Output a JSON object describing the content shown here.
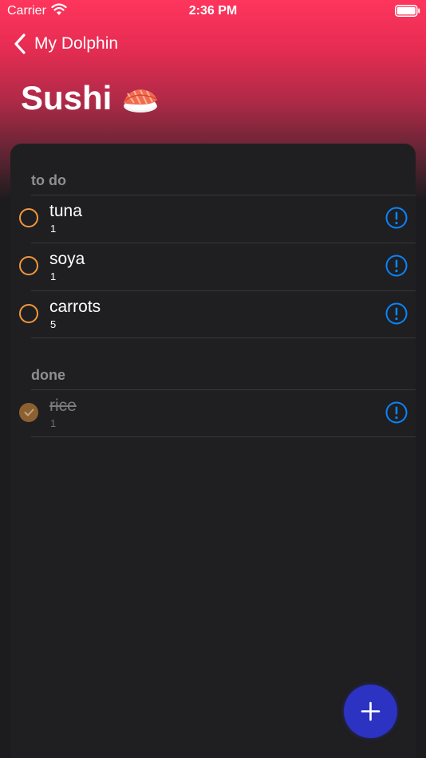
{
  "status_bar": {
    "carrier": "Carrier",
    "time": "2:36 PM"
  },
  "nav": {
    "back_label": "My Dolphin"
  },
  "title": "Sushi",
  "sections": [
    {
      "header": "to do",
      "items": [
        {
          "name": "tuna",
          "quantity": "1",
          "done": false
        },
        {
          "name": "soya",
          "quantity": "1",
          "done": false
        },
        {
          "name": "carrots",
          "quantity": "5",
          "done": false
        }
      ]
    },
    {
      "header": "done",
      "items": [
        {
          "name": "rice",
          "quantity": "1",
          "done": true
        }
      ]
    }
  ],
  "colors": {
    "accent": "#ff355d",
    "checkbox": "#f2983d",
    "info": "#0a84ff",
    "fab": "#2c32c2",
    "card": "#1f1f21"
  },
  "icons": [
    "wifi-icon",
    "battery-icon",
    "chevron-left-icon",
    "sushi-icon",
    "info-icon",
    "checkmark-icon",
    "plus-icon"
  ]
}
